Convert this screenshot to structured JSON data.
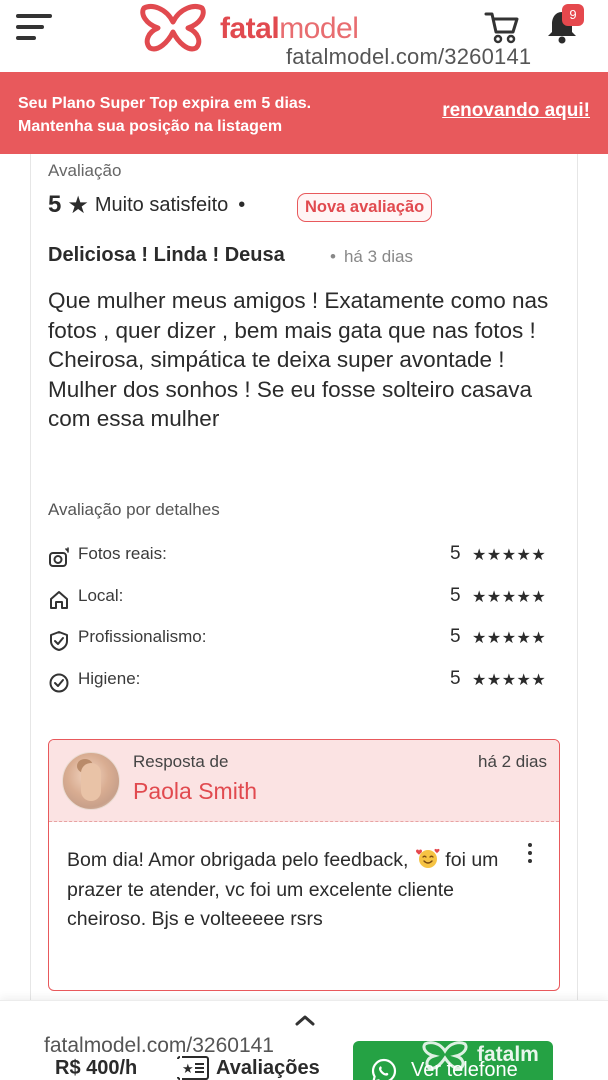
{
  "header": {
    "logo_text_bold": "fatal",
    "logo_text_light": "model",
    "notification_count": "9",
    "watermark": "fatalmodel.com/3260141"
  },
  "banner": {
    "line1": "Seu Plano Super Top expira em 5 dias.",
    "line2": "Mantenha sua posição na listagem",
    "link": "renovando aqui!"
  },
  "review": {
    "section_label": "Avaliação",
    "score": "5",
    "star": "★",
    "satisfaction": "Muito satisfeito",
    "separator": "•",
    "badge": "Nova avaliação",
    "title": "Deliciosa ! Linda ! Deusa",
    "time": "há 3 dias",
    "body": "Que mulher meus amigos ! Exatamente como nas fotos , quer dizer , bem mais gata que nas fotos ! Cheirosa, simpática te deixa super avontade ! Mulher dos sonhos ! Se eu fosse solteiro casava com essa mulher"
  },
  "details": {
    "label": "Avaliação por detalhes",
    "items": [
      {
        "icon": "camera-icon",
        "label": "Fotos reais:",
        "value": "5",
        "stars": "★★★★★"
      },
      {
        "icon": "home-icon",
        "label": "Local:",
        "value": "5",
        "stars": "★★★★★"
      },
      {
        "icon": "shield-check-icon",
        "label": "Profissionalismo:",
        "value": "5",
        "stars": "★★★★★"
      },
      {
        "icon": "check-circle-icon",
        "label": "Higiene:",
        "value": "5",
        "stars": "★★★★★"
      }
    ]
  },
  "response": {
    "label": "Resposta de",
    "name": "Paola Smith",
    "time": "há 2 dias",
    "body_part1": "Bom dia! Amor obrigada pelo feedback, ",
    "body_part2": " foi um prazer te atender, vc foi um excelente cliente cheiroso. Bjs e volteeeee rsrs"
  },
  "footer": {
    "watermark": "fatalmodel.com/3260141",
    "price": "R$ 400/h",
    "reviews_label": "Avaliações",
    "call_label": "Ver telefone",
    "call_watermark": "fatalm"
  },
  "colors": {
    "brand": "#e14a4f",
    "banner": "#e8595c",
    "whatsapp": "#25a244"
  }
}
